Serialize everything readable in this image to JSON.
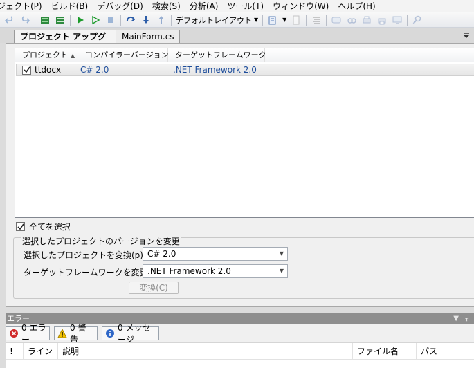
{
  "menu": {
    "items": [
      "ジェクト(P)",
      "ビルド(B)",
      "デバッグ(D)",
      "検索(S)",
      "分析(A)",
      "ツール(T)",
      "ウィンドウ(W)",
      "ヘルプ(H)"
    ]
  },
  "toolbar": {
    "layout_label": "デフォルトレイアウト",
    "icons": [
      "undo-icon",
      "redo-icon",
      "build-icon",
      "rebuild-icon",
      "run-icon",
      "run-without-debug-icon",
      "stop-icon",
      "step-over-icon",
      "step-into-icon",
      "step-out-icon",
      "layout-dropdown",
      "bookmark-icon",
      "document-icon",
      "align-icon",
      "comment-icon",
      "find-icon",
      "print-icon",
      "printer-icon",
      "monitor-icon",
      "search-icon"
    ]
  },
  "tabs": {
    "active": "プロジェクト アップグレード",
    "inactive": "MainForm.cs"
  },
  "list": {
    "headers": [
      "プロジェクト",
      "コンパイラーバージョン",
      "ターゲットフレームワーク"
    ],
    "rows": [
      {
        "checked": true,
        "project": "ttdocx",
        "compiler": "C# 2.0",
        "framework": ".NET Framework 2.0"
      }
    ]
  },
  "select_all": {
    "label": "全てを選択",
    "checked": true
  },
  "group": {
    "title": "選択したプロジェクトのバージョンを変更",
    "compiler_label": "選択したプロジェクトを変換(p) :",
    "compiler_value": "C# 2.0",
    "framework_label": "ターゲットフレームワークを変更(t) :",
    "framework_value": ".NET Framework 2.0",
    "convert_button": "変換(C)"
  },
  "errors": {
    "title": "エラー",
    "filters": [
      "0 エラー",
      "0 警告",
      "0 メッセージ"
    ],
    "columns": [
      "!",
      "ライン",
      "説明",
      "ファイル名",
      "パス"
    ]
  },
  "colors": {
    "accent_blue": "#1f4e9b",
    "run_green": "#1a9a2a",
    "error_red": "#d02b2b",
    "warning_yellow": "#f2c200"
  }
}
